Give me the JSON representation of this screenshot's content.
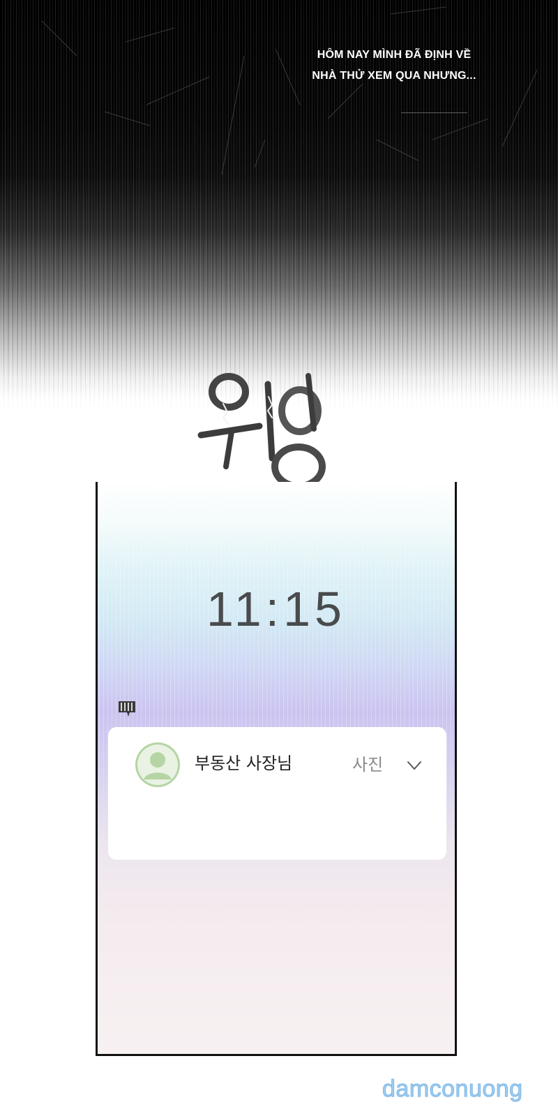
{
  "caption": {
    "line1": "HÔM NAY MÌNH ĐÃ ĐỊNH VỀ",
    "line2": "NHÀ THỬ XEM QUA NHƯNG..."
  },
  "sfx": "위잉",
  "phone": {
    "clock": "11:15",
    "notification": {
      "sender": "부동산 사장님",
      "kind": "사진",
      "expand_icon": "chevron-down-icon",
      "avatar_icon": "person-icon",
      "app_icon": "message-icon"
    }
  },
  "watermark": "damconuong",
  "colors": {
    "avatar": "#b5d5a4",
    "watermark": "#9ecdf0"
  }
}
